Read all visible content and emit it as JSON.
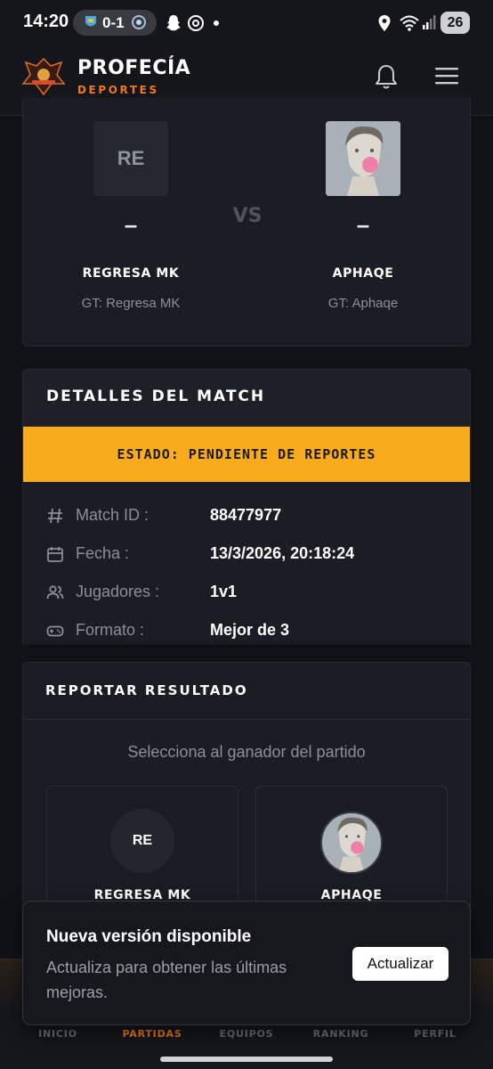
{
  "status_bar": {
    "time": "14:20",
    "score": "0-1",
    "battery": "26",
    "icons": [
      "team-crest-icon",
      "snapchat-icon",
      "threads-icon",
      "notification-dot",
      "location-icon",
      "wifi-icon",
      "signal-icon",
      "battery-icon"
    ]
  },
  "header": {
    "brand_title": "PROFECÍA",
    "brand_subtitle": "DEPORTES",
    "icons": [
      "logo",
      "bell-icon",
      "menu-icon"
    ]
  },
  "match": {
    "player1": {
      "initials": "RE",
      "score": "–",
      "name": "REGRESA MK",
      "gt": "GT: Regresa MK"
    },
    "vs": "VS",
    "player2": {
      "score": "–",
      "name": "APHAQE",
      "gt": "GT: Aphaqe"
    }
  },
  "details": {
    "title": "DETALLES DEL MATCH",
    "status": "ESTADO: PENDIENTE DE REPORTES",
    "status_color": "#f9ab1e",
    "rows": [
      {
        "icon": "hash-icon",
        "label": "Match ID :",
        "value": "88477977"
      },
      {
        "icon": "calendar-icon",
        "label": "Fecha :",
        "value": "13/3/2026, 20:18:24"
      },
      {
        "icon": "users-icon",
        "label": "Jugadores :",
        "value": "1v1"
      },
      {
        "icon": "gamepad-icon",
        "label": "Formato :",
        "value": "Mejor de 3"
      }
    ]
  },
  "report": {
    "title": "REPORTAR RESULTADO",
    "hint": "Selecciona al ganador del partido",
    "options": [
      {
        "initials": "RE",
        "name": "REGRESA MK"
      },
      {
        "name": "APHAQE"
      }
    ]
  },
  "nav": {
    "items": [
      {
        "label": "INICIO",
        "active": false
      },
      {
        "label": "PARTIDAS",
        "active": true
      },
      {
        "label": "EQUIPOS",
        "active": false
      },
      {
        "label": "RANKING",
        "active": false
      },
      {
        "label": "PERFIL",
        "active": false
      }
    ],
    "accent": "#f0791f"
  },
  "toast": {
    "title": "Nueva versión disponible",
    "body": "Actualiza para obtener las últimas mejoras.",
    "button": "Actualizar"
  }
}
